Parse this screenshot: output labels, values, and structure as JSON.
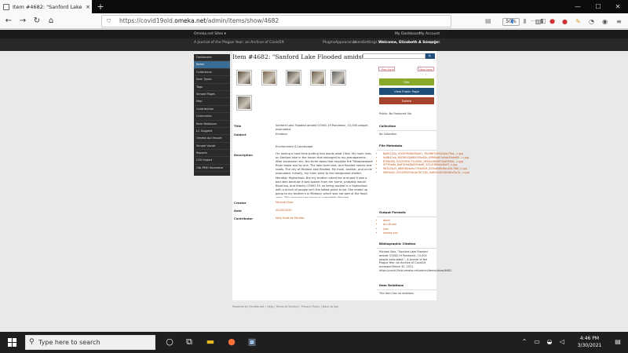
{
  "browser": {
    "tab_title": "Item #4682: \"Sanford Lake Floo",
    "tab_close": "×",
    "new_tab": "+",
    "url_prefix": "https://covid19old.",
    "url_domain": "omeka.net",
    "url_path": "/admin/items/show/4682",
    "zoom": "50%",
    "win_min": "—",
    "win_max": "☐",
    "win_close": "✕"
  },
  "omeka_bar": {
    "sites": "Omeka.net Sites ▾",
    "my_dashboard": "My Dashboard",
    "my_account": "My Account"
  },
  "site_bar": {
    "site_title": "A Journal of the Plague Year: an Archive of Covid19",
    "links": [
      "Plugins",
      "Appearance",
      "Users",
      "Settings"
    ],
    "welcome": "Welcome, Elizabeth A Scrooge",
    "logout": "Log Out"
  },
  "sidebar": {
    "items": [
      "Dashboard",
      "Items",
      "Collections",
      "Item Types",
      "Tags",
      "Simple Pages",
      "Map",
      "Contribution",
      "Comments",
      "Item Relations",
      "LC Suggest",
      "Omeka Api Import",
      "Simple Vocab",
      "Reports",
      "CSV Import",
      "OAI-PMH Harvester"
    ],
    "active_index": 1
  },
  "page": {
    "title": "Item #4682: \"Sanford Lake Flooded amidst COVI...",
    "search_button": "🔍",
    "prev_item": "‹ Prev Item",
    "next_item": "Next Item ›"
  },
  "thumbnails": [
    {
      "color": "#5b4a3a"
    },
    {
      "color": "#7a6248"
    },
    {
      "color": "#4f4a44"
    },
    {
      "color": "#6e5a45"
    },
    {
      "color": "#5a5e60"
    },
    {
      "color": "#6b6456"
    }
  ],
  "metadata": {
    "title_label": "Title",
    "title_value": "Sanford Lake Flooded amidst COVID-19 Pandemic, 10,000 people evacuated.",
    "subject_label": "Subject",
    "subject_value": "Emotion",
    "env_value": "Environment & Landscape",
    "description_label": "Description",
    "description_value": "I'm having a hard time putting into words what I feel. My mom lives on Sanford lake in the house that belonged to my grandparents. After excessive rain, the three dams that regulate the Tittabawassee River broke one by one. The lake level rose, and flooded homes and roads. The city of Midland also flooded. My mom, brother, and uncle evacuated. Initially, my mom went to the designated shelter- Meridian Highschool. But my brother called her and said it was a bad idea because it was sponer from her home, probably would flood too, and thanks COVID-19, so being packed in a highschool with a bunch of people isn't the safest place to be. She ended up going to my brother's in Midland, which was not part of the flood zone. This morning her house is completely flooded.",
    "creator_label": "Creator",
    "creator_value": "Michael Sole",
    "date_label": "Date",
    "date_value": "05/20/2020",
    "contributor_label": "Contributor",
    "contributor_value": "Katy Kidd de Peralta"
  },
  "actions": {
    "edit": "Edit",
    "view_public": "View Public Page",
    "delete": "Delete",
    "public": "Public: No",
    "featured": "Featured: No"
  },
  "colors": {
    "edit": "#8aaa2c",
    "view_public": "#1d4f7a",
    "delete": "#a5432c",
    "link": "#c65a1a",
    "active_nav": "#3a6c94"
  },
  "collection": {
    "heading": "Collection",
    "value": "No Collection"
  },
  "file_metadata": {
    "heading": "File Metadata",
    "files": [
      "8a65152a_9203f9f26bf93a01_7fb5f8f7b9f1d3be7fdd...n.jpg",
      "9c8842ab_6f03f60346692f5a40b_8ff9f0d67a9da35de6f5...n.jpg",
      "87f8c8f0_9202f9f2fc732859f_2696b2f6b9f70df99f4b...n.jpg",
      "9f790a6a_8a67b9d38d3f4da8f_323c5f82d2d6d7f_n.jpg",
      "98322b25_8869804a9e739a0f08_8264a9f6c8ec6d1786f_n.jpg",
      "9f6f4d42_9202f9f2f59c4e787185_4a85c04b78f1d6e3a7b...n.jpg"
    ]
  },
  "output_formats": {
    "heading": "Output Formats",
    "items": [
      "atom",
      "dc-rdf-xml",
      "json",
      "omeka-xml"
    ]
  },
  "citation": {
    "heading": "Bibliographic Citation",
    "text": "Michael Sole, \"Sanford Lake Flooded amidst COVID-19 Pandemic, 10,000 people evacuated.\", A Journal of the Plague Year: an Archive of Covid19, accessed March 30, 2021, https://covid19old.omeka.net/admin/items/show/4682."
  },
  "relations": {
    "heading": "Item Relations",
    "text": "This item has no relations."
  },
  "footer": "Powered by Omeka.net | Help | Terms of Service | Privacy Policy | Back to top",
  "taskbar": {
    "search_placeholder": "Type here to search",
    "time": "4:46 PM",
    "date": "3/30/2021"
  }
}
